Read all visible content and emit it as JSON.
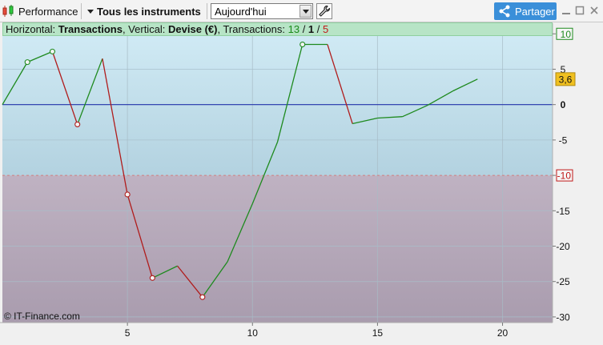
{
  "toolbar": {
    "performance_label": "Performance",
    "instruments_label": "Tous les instruments",
    "period_value": "Aujourd'hui",
    "share_label": "Partager"
  },
  "info": {
    "horizontal_prefix": "Horizontal: ",
    "horizontal_value": "Transactions",
    "vertical_prefix": ", Vertical: ",
    "vertical_value": "Devise (€)",
    "transactions_prefix": ", Transactions: ",
    "tx_win": "13",
    "tx_slash1": " / ",
    "tx_neutral": "1",
    "tx_slash2": " / ",
    "tx_loss": "5"
  },
  "copyright": "© IT-Finance.com",
  "colors": {
    "gain": "#1e8a1e",
    "loss": "#b01c1c",
    "zero_line": "#2233aa",
    "upper_bg": "#c9e6f2",
    "lower_bg": "#b5a8b8"
  },
  "chart_data": {
    "type": "line",
    "x": [
      0,
      1,
      2,
      3,
      4,
      5,
      6,
      7,
      8,
      9,
      10,
      11,
      12,
      13,
      14,
      15,
      16,
      17,
      18,
      19
    ],
    "values": [
      0,
      6,
      7.5,
      -2.8,
      6.5,
      -12.7,
      -24.5,
      -22.8,
      -27.2,
      -22.2,
      -14,
      -5.3,
      8.5,
      8.5,
      -2.7,
      -1.9,
      -1.7,
      -0.1,
      1.9,
      3.6
    ],
    "markers": [
      1,
      2,
      3,
      5,
      6,
      8,
      12
    ],
    "xlim": [
      0,
      22
    ],
    "ylim": [
      -30.8,
      11.5
    ],
    "x_ticks": [
      5,
      10,
      15,
      20
    ],
    "y_ticks": [
      10,
      5,
      0,
      -5,
      -10,
      -15,
      -20,
      -25,
      -30
    ],
    "y_tick_labels": [
      "10",
      "5",
      "0",
      "-5",
      "-10",
      "-15",
      "-20",
      "-25",
      "-30"
    ],
    "upper_threshold": 10,
    "lower_threshold": -10,
    "last_value_label": "3,6",
    "grid": true
  }
}
